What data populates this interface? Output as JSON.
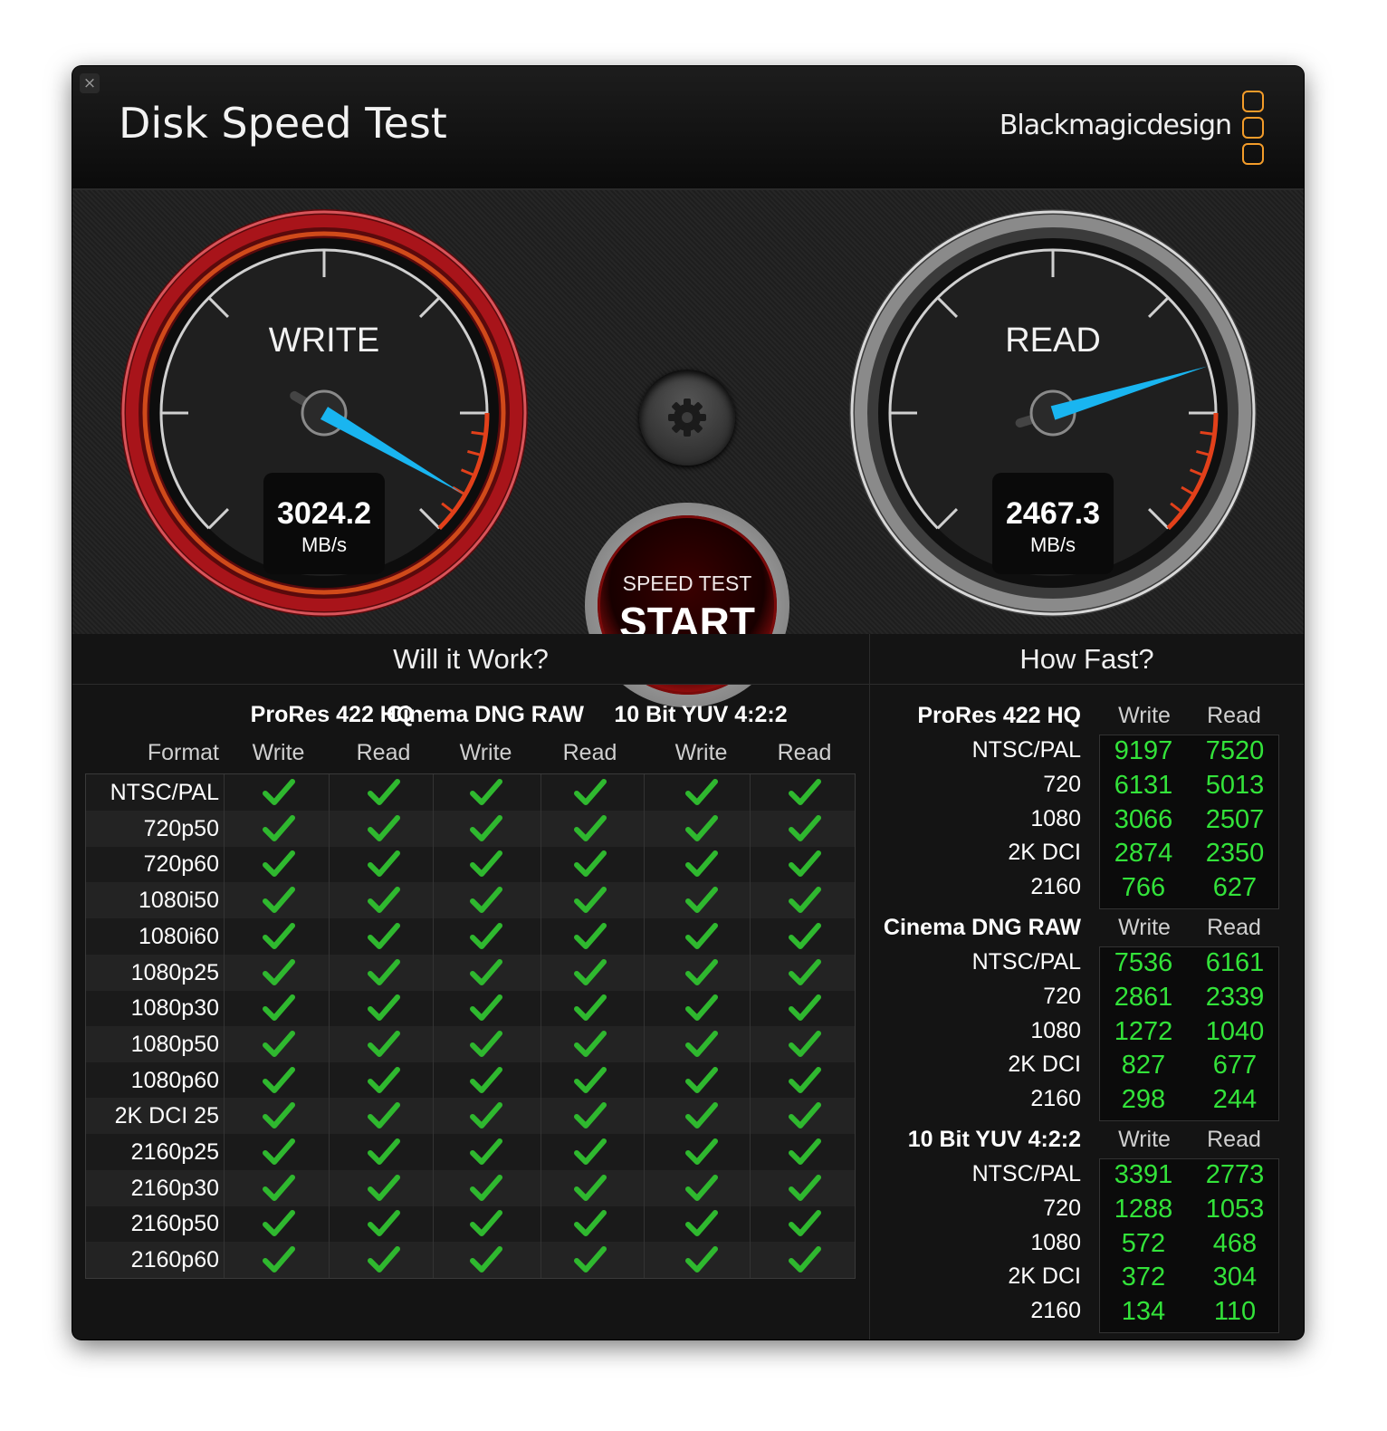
{
  "window": {
    "title": "Disk Speed Test",
    "close_icon": "close-icon",
    "brand": "Blackmagicdesign",
    "brand_logo_color": "#f39c2a"
  },
  "gauges": {
    "write": {
      "label": "WRITE",
      "value": "3024.2",
      "unit": "MB/s",
      "needle_color": "#19b5f0",
      "ring_color": "#b3181d"
    },
    "read": {
      "label": "READ",
      "value": "2467.3",
      "unit": "MB/s",
      "needle_color": "#19b5f0",
      "ring_color": "#cfcfcf"
    },
    "gauge_max": 3200
  },
  "controls": {
    "settings_icon": "gear-icon",
    "start_top": "SPEED TEST",
    "start_main": "START"
  },
  "will_it_work": {
    "heading": "Will it Work?",
    "format_header": "Format",
    "groups": [
      "ProRes 422 HQ",
      "Cinema DNG RAW",
      "10 Bit YUV 4:2:2"
    ],
    "columns": [
      "Write",
      "Read",
      "Write",
      "Read",
      "Write",
      "Read"
    ],
    "formats": [
      "NTSC/PAL",
      "720p50",
      "720p60",
      "1080i50",
      "1080i60",
      "1080p25",
      "1080p30",
      "1080p50",
      "1080p60",
      "2K DCI 25",
      "2160p25",
      "2160p30",
      "2160p50",
      "2160p60"
    ],
    "check_icon": "checkmark-icon",
    "check_color": "#2fb82f"
  },
  "how_fast": {
    "heading": "How Fast?",
    "write_label": "Write",
    "read_label": "Read",
    "groups": [
      {
        "name": "ProRes 422 HQ",
        "rows": [
          {
            "label": "NTSC/PAL",
            "write": "9197",
            "read": "7520"
          },
          {
            "label": "720",
            "write": "6131",
            "read": "5013"
          },
          {
            "label": "1080",
            "write": "3066",
            "read": "2507"
          },
          {
            "label": "2K DCI",
            "write": "2874",
            "read": "2350"
          },
          {
            "label": "2160",
            "write": "766",
            "read": "627"
          }
        ]
      },
      {
        "name": "Cinema DNG RAW",
        "rows": [
          {
            "label": "NTSC/PAL",
            "write": "7536",
            "read": "6161"
          },
          {
            "label": "720",
            "write": "2861",
            "read": "2339"
          },
          {
            "label": "1080",
            "write": "1272",
            "read": "1040"
          },
          {
            "label": "2K DCI",
            "write": "827",
            "read": "677"
          },
          {
            "label": "2160",
            "write": "298",
            "read": "244"
          }
        ]
      },
      {
        "name": "10 Bit YUV 4:2:2",
        "rows": [
          {
            "label": "NTSC/PAL",
            "write": "3391",
            "read": "2773"
          },
          {
            "label": "720",
            "write": "1288",
            "read": "1053"
          },
          {
            "label": "1080",
            "write": "572",
            "read": "468"
          },
          {
            "label": "2K DCI",
            "write": "372",
            "read": "304"
          },
          {
            "label": "2160",
            "write": "134",
            "read": "110"
          }
        ]
      }
    ],
    "value_color": "#33e33a"
  }
}
